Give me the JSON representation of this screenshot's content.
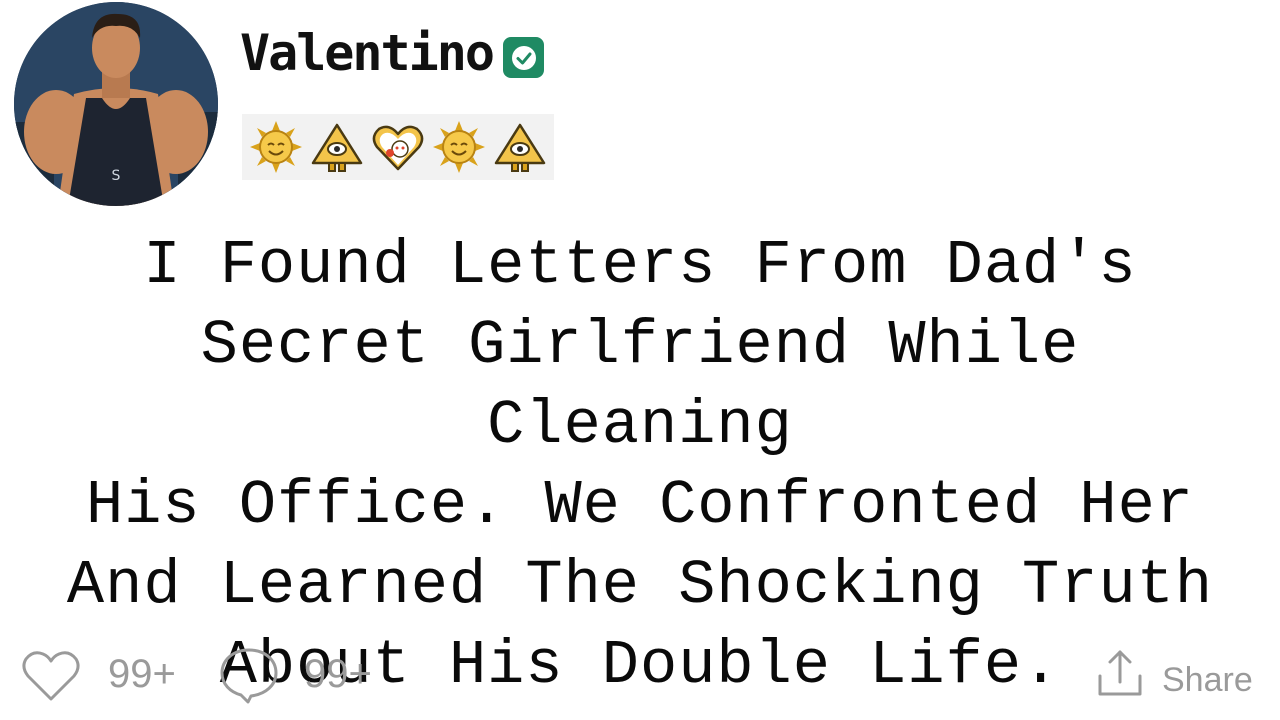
{
  "post": {
    "author": {
      "name": "Valentino",
      "verified": true,
      "verified_color": "#1f8a63",
      "avatar_icon": "avatar-photo"
    },
    "badges": [
      {
        "icon": "sun-award-icon"
      },
      {
        "icon": "pyramid-eye-award-icon"
      },
      {
        "icon": "heart-snoo-award-icon"
      },
      {
        "icon": "sun-award-icon"
      },
      {
        "icon": "pyramid-eye-award-icon"
      }
    ],
    "title": "I Found Letters From Dad's Secret Girlfriend While Cleaning His Office. We Confronted Her And Learned The Shocking Truth About His Double Life.",
    "title_lines": [
      "I Found Letters From Dad's",
      "Secret Girlfriend While Cleaning",
      "His Office. We Confronted Her",
      "And Learned The Shocking Truth",
      "About His Double Life."
    ]
  },
  "actions": {
    "like_count": "99+",
    "comment_count": "99+",
    "share_label": "Share",
    "icon_color": "#9a9a9a"
  }
}
